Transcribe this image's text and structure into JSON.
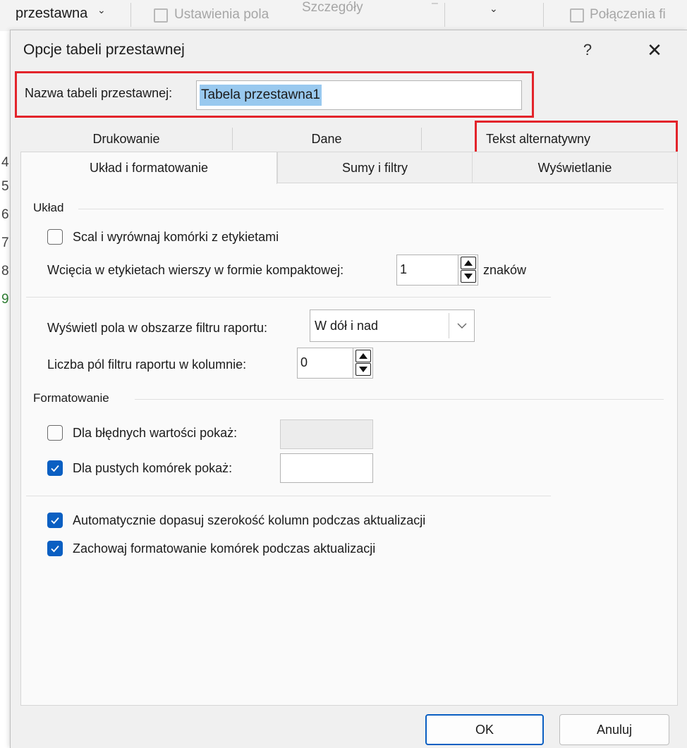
{
  "ribbon": {
    "pivot_name_label": "przestawna",
    "field_settings": "Ustawienia pola",
    "details": "Szczegóły",
    "connections": "Połączenia fi"
  },
  "left_strip_glyphs": [
    "4",
    "5",
    "6",
    "7",
    "8",
    "9"
  ],
  "dialog": {
    "title": "Opcje tabeli przestawnej",
    "help": "?",
    "close": "✕",
    "name_label": "Nazwa tabeli przestawnej:",
    "name_value": "Tabela przestawna1",
    "tabs_row1": [
      "Drukowanie",
      "Dane",
      "Tekst alternatywny"
    ],
    "tabs_row2": [
      "Układ i formatowanie",
      "Sumy i filtry",
      "Wyświetlanie"
    ],
    "active_tab": "Układ i formatowanie",
    "layout": {
      "group": "Układ",
      "merge_label": "Scal i wyrównaj komórki z etykietami",
      "merge_checked": false,
      "indent_label": "Wcięcia w etykietach wierszy w formie kompaktowej:",
      "indent_value": "1",
      "indent_unit": "znaków",
      "filter_area_label": "Wyświetl pola w obszarze filtru raportu:",
      "filter_area_value": "W dół i nad",
      "filter_count_label": "Liczba pól filtru raportu w kolumnie:",
      "filter_count_value": "0"
    },
    "formatting": {
      "group": "Formatowanie",
      "error_label": "Dla błędnych wartości pokaż:",
      "error_checked": false,
      "error_value": "",
      "empty_label": "Dla pustych komórek pokaż:",
      "empty_checked": true,
      "empty_value": "",
      "autofit_label": "Automatycznie dopasuj szerokość kolumn podczas aktualizacji",
      "autofit_checked": true,
      "preserve_label": "Zachowaj formatowanie komórek podczas aktualizacji",
      "preserve_checked": true
    },
    "ok": "OK",
    "cancel": "Anuluj"
  },
  "colors": {
    "accent": "#0a5fc2",
    "highlight_box": "#e3242b",
    "selection": "#99c9ef"
  }
}
